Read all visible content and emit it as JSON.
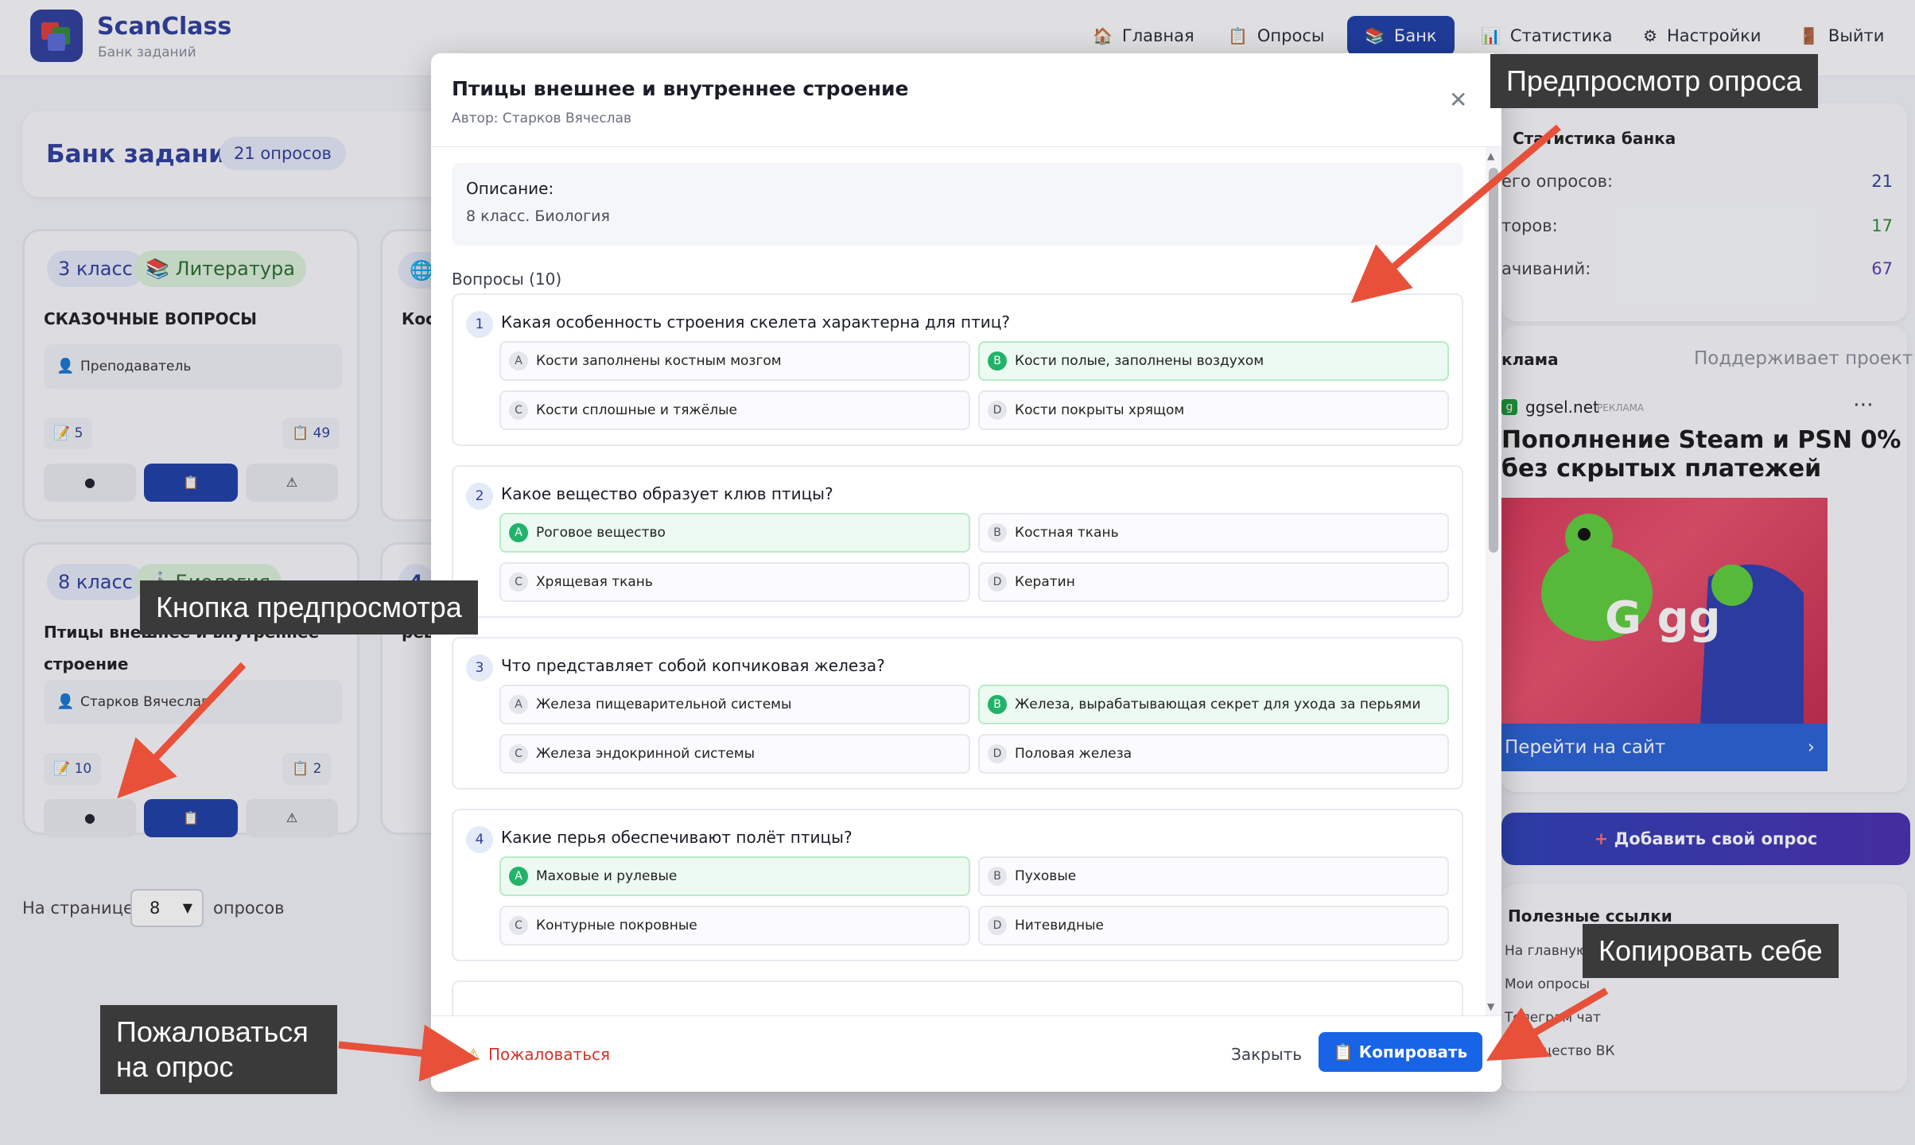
{
  "header": {
    "brand": "ScanClass",
    "brand_sub": "Банк заданий",
    "nav": [
      {
        "label": "Главная",
        "icon": "home-icon",
        "glyph": "🏠"
      },
      {
        "label": "Опросы",
        "icon": "clipboard-icon",
        "glyph": "📋"
      },
      {
        "label": "Банк",
        "icon": "bank-icon",
        "glyph": "📚"
      },
      {
        "label": "Статистика",
        "icon": "chart-icon",
        "glyph": "📊"
      },
      {
        "label": "Настройки",
        "icon": "gear-icon",
        "glyph": "⚙"
      },
      {
        "label": "Выйти",
        "icon": "door-icon",
        "glyph": "🚪"
      }
    ]
  },
  "bank": {
    "title": "Банк заданий",
    "count_badge": "21 опросов"
  },
  "cards": [
    {
      "grade": "3 класс",
      "subject": "Литература",
      "title": "СКАЗОЧНЫЕ ВОПРОСЫ",
      "author": "Преподаватель",
      "stat_left": "5",
      "stat_right": "49"
    },
    {
      "grade": "8 класс",
      "subject": "Биология",
      "title_line1": "Птицы внешнее и внутреннее",
      "title_line2": "строение",
      "author": "Старков Вячеслав",
      "stat_left": "10",
      "stat_right": "2"
    },
    {
      "title_fragment": "Косм"
    },
    {
      "grade_fragment": "4",
      "title_fragment": "реш"
    }
  ],
  "pagination": {
    "label_before": "На странице:",
    "value": "8",
    "label_after": "опросов"
  },
  "sidebar": {
    "stats_title": "Статистика банка",
    "stats": [
      {
        "label": "его опросов:",
        "value": "21"
      },
      {
        "label": "торов:",
        "value": "17"
      },
      {
        "label": "ачиваний:",
        "value": "67"
      }
    ],
    "ad_label": "клама",
    "ad_support": "Поддерживает проект",
    "ad_domain": "ggsel.net",
    "ad_tag": "РЕКЛАМА",
    "ad_headline_1": "Пополнение Steam и PSN 0%",
    "ad_headline_2": "без скрытых платежей",
    "ad_button": "Перейти на сайт",
    "add_button": "Добавить свой опрос",
    "links_title": "Полезные ссылки",
    "links": [
      "На главную",
      "Мои опросы",
      "Телеграм чат",
      "Сообщество ВК"
    ]
  },
  "modal": {
    "title": "Птицы внешнее и внутреннее строение",
    "author": "Автор: Старков Вячеслав",
    "description_label": "Описание:",
    "description": "8 класс. Биология",
    "questions_label": "Вопросы (10)",
    "questions": [
      {
        "n": "1",
        "text": "Какая особенность строения скелета характерна для птиц?",
        "options": [
          {
            "letter": "A",
            "text": "Кости заполнены костным мозгом",
            "correct": false
          },
          {
            "letter": "B",
            "text": "Кости полые, заполнены воздухом",
            "correct": true
          },
          {
            "letter": "C",
            "text": "Кости сплошные и тяжёлые",
            "correct": false
          },
          {
            "letter": "D",
            "text": "Кости покрыты хрящом",
            "correct": false
          }
        ]
      },
      {
        "n": "2",
        "text": "Какое вещество образует клюв птицы?",
        "options": [
          {
            "letter": "A",
            "text": "Роговое вещество",
            "correct": true
          },
          {
            "letter": "B",
            "text": "Костная ткань",
            "correct": false
          },
          {
            "letter": "C",
            "text": "Хрящевая ткань",
            "correct": false
          },
          {
            "letter": "D",
            "text": "Кератин",
            "correct": false
          }
        ]
      },
      {
        "n": "3",
        "text": "Что представляет собой копчиковая железа?",
        "options": [
          {
            "letter": "A",
            "text": "Железа пищеварительной системы",
            "correct": false
          },
          {
            "letter": "B",
            "text": "Железа, вырабатывающая секрет для ухода за перьями",
            "correct": true
          },
          {
            "letter": "C",
            "text": "Железа эндокринной системы",
            "correct": false
          },
          {
            "letter": "D",
            "text": "Половая железа",
            "correct": false
          }
        ]
      },
      {
        "n": "4",
        "text": "Какие перья обеспечивают полёт птицы?",
        "options": [
          {
            "letter": "A",
            "text": "Маховые и рулевые",
            "correct": true
          },
          {
            "letter": "B",
            "text": "Пуховые",
            "correct": false
          },
          {
            "letter": "C",
            "text": "Контурные покровные",
            "correct": false
          },
          {
            "letter": "D",
            "text": "Нитевидные",
            "correct": false
          }
        ]
      }
    ],
    "report_label": "Пожаловаться",
    "close_label": "Закрыть",
    "copy_label": "Копировать"
  },
  "annotations": {
    "preview": "Предпросмотр опроса",
    "preview_button": "Кнопка предпросмотра",
    "report_1": "Пожаловаться",
    "report_2": "на опрос",
    "copy": "Копировать себе"
  },
  "colors": {
    "primary": "#1f3fa8",
    "accent_blue": "#1764e6",
    "correct_green": "#22b36a",
    "report_red": "#d2342a",
    "arrow_red": "#e8503a"
  }
}
